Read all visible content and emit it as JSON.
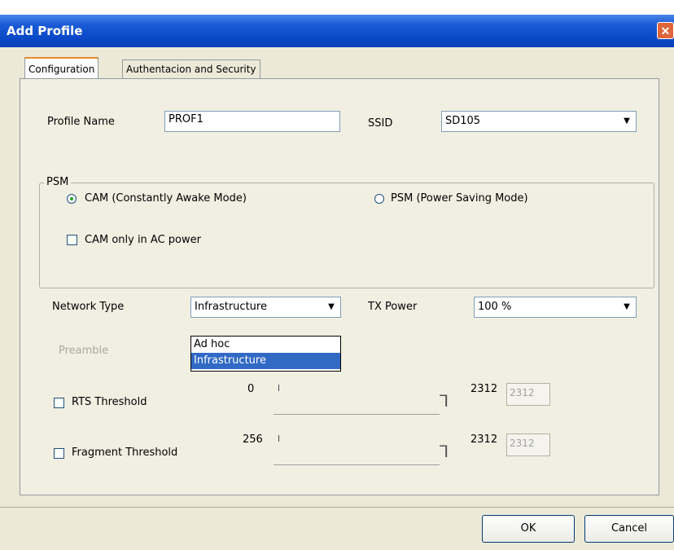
{
  "window": {
    "title": "Add Profile",
    "close_glyph": "✕"
  },
  "tabs": [
    {
      "label": "Configuration",
      "active": true
    },
    {
      "label": "Authentacion and Security",
      "active": false
    }
  ],
  "profile": {
    "name_label": "Profile Name",
    "name_value": "PROF1",
    "ssid_label": "SSID",
    "ssid_value": "SD105"
  },
  "psm": {
    "group_label": "PSM",
    "cam_label": "CAM (Constantly Awake Mode)",
    "psm_label": "PSM (Power Saving Mode)",
    "cam_ac_label": "CAM only in AC power",
    "selected": "cam"
  },
  "network": {
    "type_label": "Network Type",
    "type_value": "Infrastructure",
    "type_options": [
      "Ad hoc",
      "Infrastructure"
    ],
    "tx_label": "TX Power",
    "tx_value": "100 %",
    "preamble_label": "Preamble"
  },
  "rts": {
    "label": "RTS Threshold",
    "min": "0",
    "max": "2312",
    "value": "2312"
  },
  "fragment": {
    "label": "Fragment Threshold",
    "min": "256",
    "max": "2312",
    "value": "2312"
  },
  "buttons": {
    "ok": "OK",
    "cancel": "Cancel"
  },
  "icons": {
    "dropdown": "▼",
    "slider_thumb": "⅂"
  }
}
